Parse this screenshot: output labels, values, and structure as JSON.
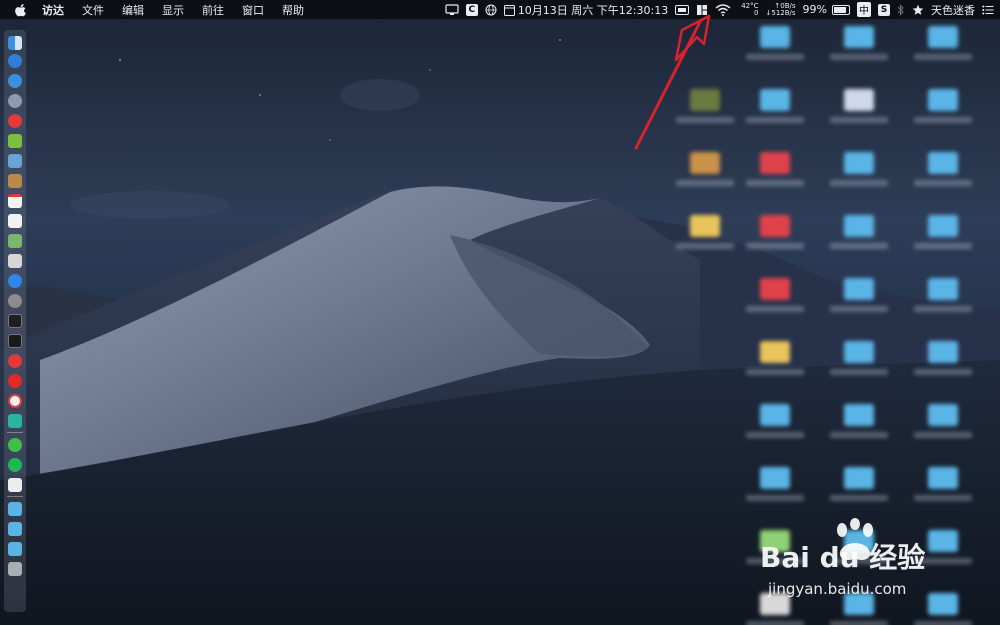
{
  "menubar": {
    "app_name": "访达",
    "menus": [
      "文件",
      "编辑",
      "显示",
      "前往",
      "窗口",
      "帮助"
    ],
    "datetime": "10月13日 周六 下午12:30:13",
    "cpu_temp": "42°C",
    "cpu_extra": "0",
    "net_up": "↑0B/s",
    "net_down": "↓512B/s",
    "battery": "99%",
    "ime": "中",
    "clip_icon_label": "C",
    "s_icon_label": "S",
    "user": "天色迷香",
    "battery_level": 0.99
  },
  "watermark": {
    "brand": "Bai du 经验",
    "url": "jingyan.baidu.com"
  },
  "colors": {
    "menubar_bg": "#0d0f14",
    "annotation_arrow": "#d8222e",
    "folder_blue": "#5ab4e6",
    "folder_red": "#e0424b",
    "folder_yellow": "#e8c45a"
  },
  "dock_icons": [
    "finder-icon",
    "safari-icon",
    "compass-icon",
    "launchpad-icon",
    "app-red-icon",
    "android-icon",
    "preview-icon",
    "notes-icon",
    "calendar-icon",
    "textedit-icon",
    "maps-icon",
    "activity-icon",
    "app-store-icon",
    "system-prefs-icon",
    "monitor-icon",
    "terminal-icon",
    "vivaldi-icon",
    "netease-music-icon",
    "yandex-icon",
    "app-green-icon",
    "wechat-icon",
    "spotify-icon",
    "script-icon",
    "folder-icon",
    "folder-icon",
    "downloads-icon",
    "trash-icon"
  ]
}
